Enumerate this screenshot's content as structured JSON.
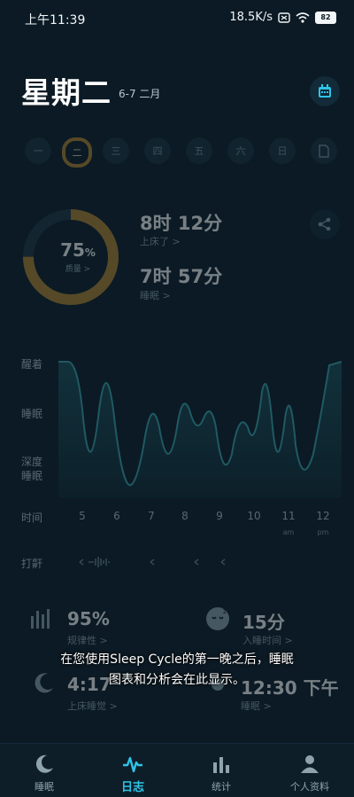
{
  "status_bar": {
    "time": "上午11:39",
    "network": "18.5K/s",
    "battery": "82"
  },
  "header": {
    "title": "星期二",
    "date_range": "6-7 二月",
    "calendar_icon": "calendar-icon"
  },
  "days": [
    {
      "label": "一"
    },
    {
      "label": "二",
      "selected": true
    },
    {
      "label": "三"
    },
    {
      "label": "四"
    },
    {
      "label": "五"
    },
    {
      "label": "六"
    },
    {
      "label": "日"
    }
  ],
  "summary": {
    "quality_value": "75",
    "quality_unit": "%",
    "quality_fraction": 0.75,
    "quality_label": "质量 >",
    "in_bed_value": "8时 12分",
    "in_bed_label": "上床了 >",
    "asleep_value": "7时 57分",
    "asleep_label": "睡眠 >"
  },
  "graph": {
    "y_labels": [
      "醒着",
      "睡眠",
      "深度",
      "睡眠"
    ],
    "x_label_title": "时间",
    "x_labels": [
      "5",
      "6",
      "7",
      "8",
      "9",
      "10",
      "11",
      "12"
    ],
    "x_sub": [
      "",
      "",
      "",
      "",
      "",
      "",
      "am",
      "pm"
    ],
    "snore_label": "打鼾",
    "accent": "#2a7c85"
  },
  "stats": {
    "regularity_value": "95%",
    "regularity_label": "规律性 >",
    "fall_asleep_value": "15分",
    "fall_asleep_label": "入睡时间 >",
    "bedtime_value": "4:17",
    "bedtime_label": "上床睡觉 >",
    "wake_value": "12:30 下午",
    "wake_label": "睡眠 >"
  },
  "toast": {
    "line1": "在您使用Sleep Cycle的第一晚之后，睡眠",
    "line2": "图表和分析会在此显示。"
  },
  "nav": [
    {
      "label": "睡眠",
      "icon": "moon-icon"
    },
    {
      "label": "日志",
      "icon": "pulse-icon",
      "active": true
    },
    {
      "label": "统计",
      "icon": "bar-chart-icon"
    },
    {
      "label": "个人资料",
      "icon": "person-icon"
    }
  ],
  "colors": {
    "background": "#0b1a24",
    "accent": "#2ec4e8",
    "ring": "#b3852e"
  }
}
